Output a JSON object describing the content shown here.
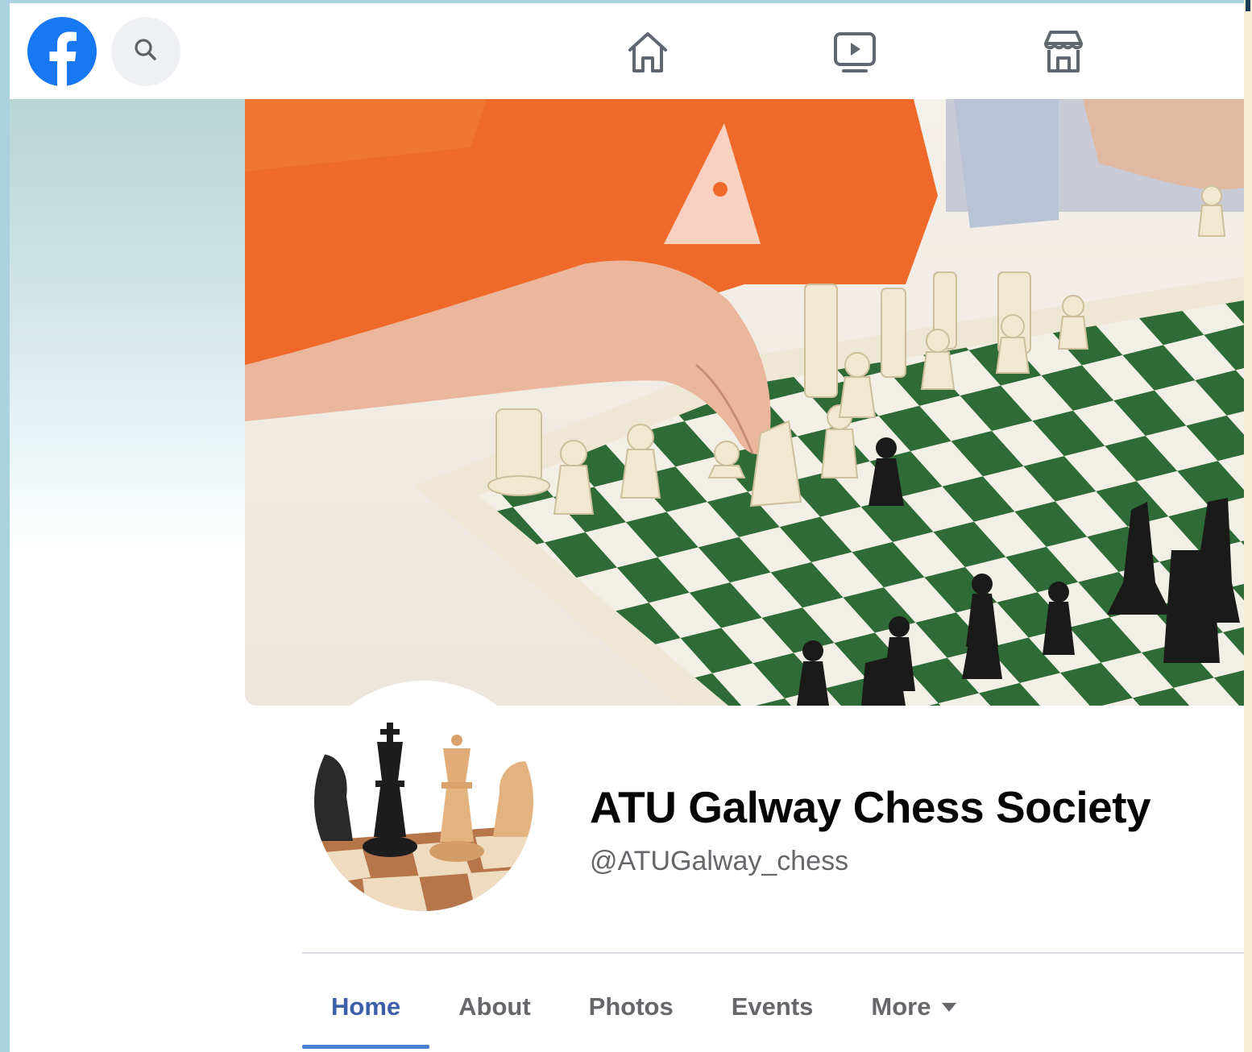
{
  "topbar": {
    "logo_icon": "facebook-logo-icon",
    "search_icon": "search-icon",
    "nav": [
      {
        "name": "home",
        "icon": "home-icon"
      },
      {
        "name": "watch",
        "icon": "video-play-icon"
      },
      {
        "name": "marketplace",
        "icon": "marketplace-shop-icon"
      }
    ]
  },
  "cover": {
    "image": "cover-photo-chess-game"
  },
  "profile": {
    "avatar_image": "profile-photo-chess-king-queen",
    "name": "ATU Galway Chess Society",
    "handle": "@ATUGalway_chess"
  },
  "tabs": [
    {
      "label": "Home",
      "active": true
    },
    {
      "label": "About",
      "active": false
    },
    {
      "label": "Photos",
      "active": false
    },
    {
      "label": "Events",
      "active": false
    },
    {
      "label": "More",
      "active": false,
      "dropdown": true
    }
  ],
  "colors": {
    "brand_blue": "#1877f2",
    "active_tab": "#3b5fa8",
    "inactive_tab": "#65676b",
    "outer_background": "#a9d1e0"
  }
}
